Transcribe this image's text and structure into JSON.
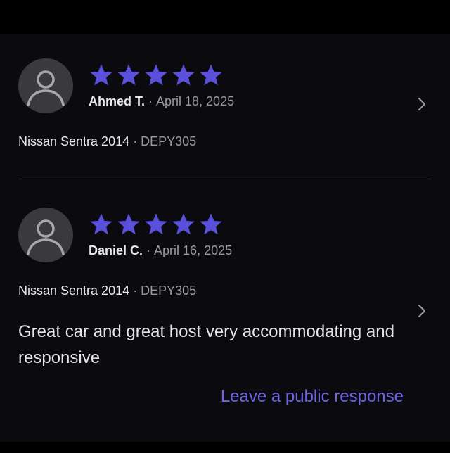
{
  "theme": {
    "star_color": "#5a50dc",
    "link_color": "#6d64e0",
    "background": "#0b0b0f"
  },
  "reviews": [
    {
      "rating": 5,
      "reviewer": "Ahmed T.",
      "separator": "·",
      "date": "April 18, 2025",
      "car": "Nissan Sentra 2014",
      "plate": "DEPY305",
      "text": ""
    },
    {
      "rating": 5,
      "reviewer": "Daniel C.",
      "separator": "·",
      "date": "April 16, 2025",
      "car": "Nissan Sentra 2014",
      "plate": "DEPY305",
      "text": "Great car and great host very accommodating and responsive",
      "response_link": "Leave a public response"
    }
  ],
  "icons": {
    "avatar": "user-silhouette-icon",
    "rating": "star-icon",
    "navigate": "chevron-right-icon"
  }
}
